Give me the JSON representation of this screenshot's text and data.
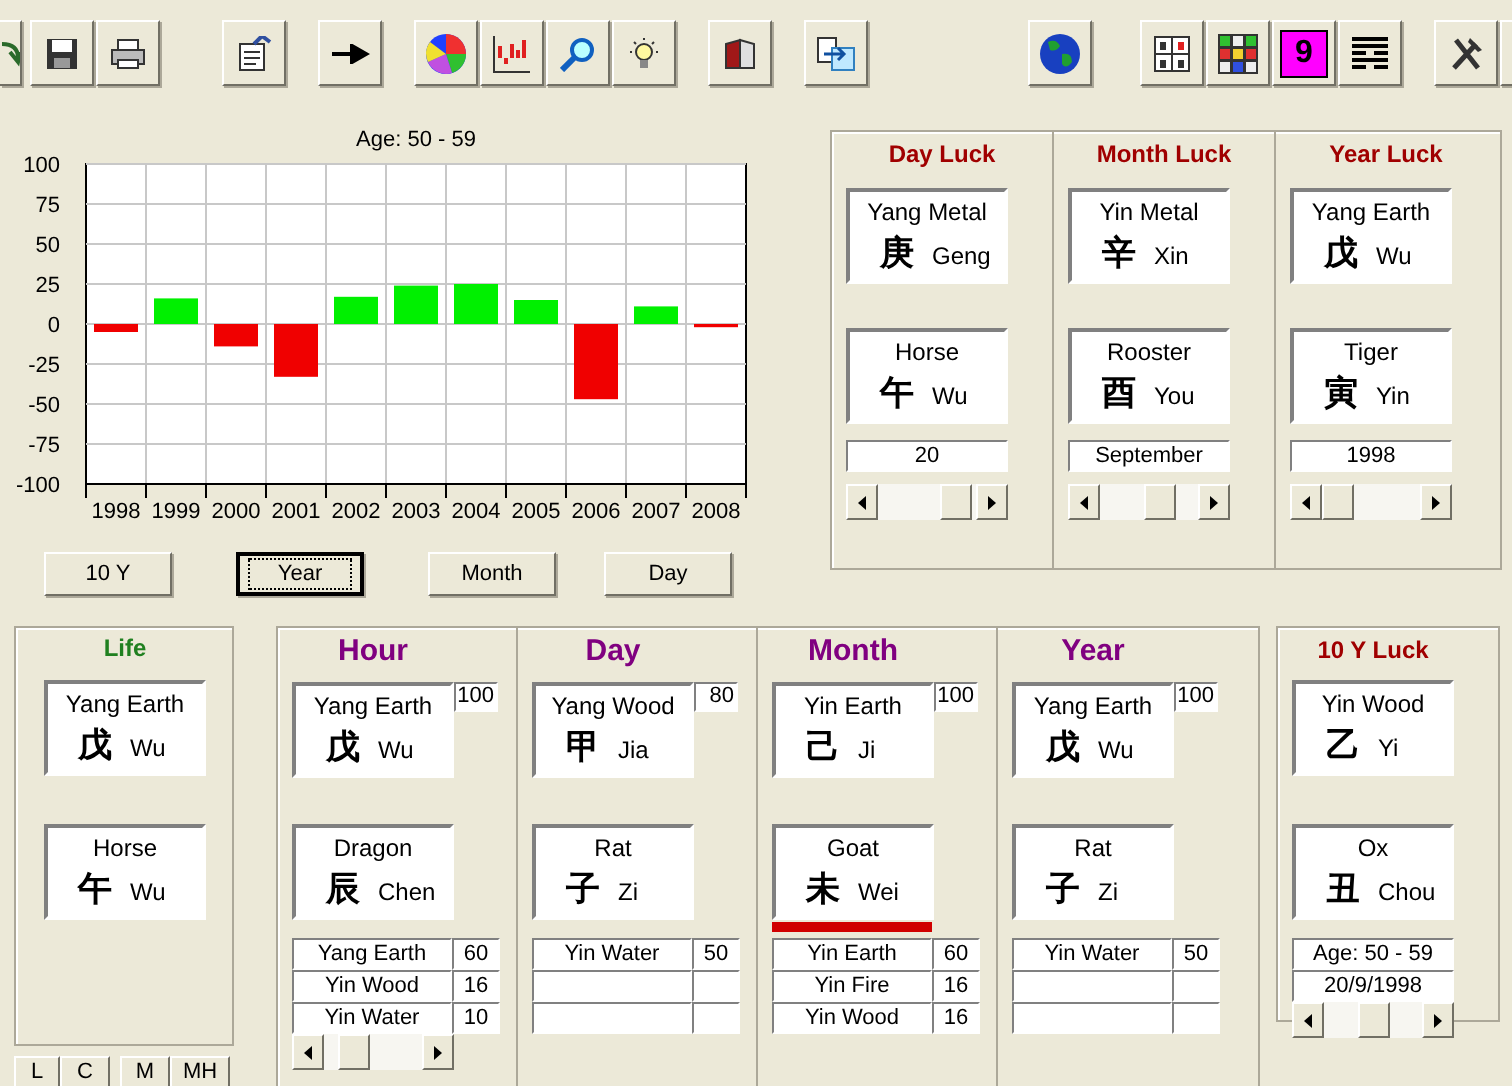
{
  "toolbar": {
    "number_button": "9"
  },
  "chart": {
    "title": "Age: 50 - 59",
    "chart_data": {
      "type": "bar",
      "categories": [
        "1998",
        "1999",
        "2000",
        "2001",
        "2002",
        "2003",
        "2004",
        "2005",
        "2006",
        "2007",
        "2008"
      ],
      "values": [
        -5,
        16,
        -14,
        -33,
        17,
        24,
        25,
        15,
        -47,
        11,
        -2
      ],
      "ylim": [
        -100,
        100
      ],
      "grid": true,
      "yticks": [
        100,
        75,
        50,
        25,
        0,
        -25,
        -50,
        -75,
        -100
      ]
    }
  },
  "period_buttons": [
    {
      "label": "10 Y",
      "selected": false
    },
    {
      "label": "Year",
      "selected": true
    },
    {
      "label": "Month",
      "selected": false
    },
    {
      "label": "Day",
      "selected": false
    }
  ],
  "luck_panels": [
    {
      "title": "Day Luck",
      "stem": {
        "element": "Yang Metal",
        "glyph": "庚",
        "pinyin": "Geng"
      },
      "branch": {
        "animal": "Horse",
        "glyph": "午",
        "pinyin": "Wu"
      },
      "value": "20",
      "level": 0.95
    },
    {
      "title": "Month Luck",
      "stem": {
        "element": "Yin Metal",
        "glyph": "辛",
        "pinyin": "Xin"
      },
      "branch": {
        "animal": "Rooster",
        "glyph": "酉",
        "pinyin": "You"
      },
      "value": "September",
      "level": 0.67
    },
    {
      "title": "Year Luck",
      "stem": {
        "element": "Yang Earth",
        "glyph": "戊",
        "pinyin": "Wu"
      },
      "branch": {
        "animal": "Tiger",
        "glyph": "寅",
        "pinyin": "Yin"
      },
      "value": "1998",
      "level": 0
    }
  ],
  "life": {
    "title": "Life",
    "stem": {
      "element": "Yang Earth",
      "glyph": "戊",
      "pinyin": "Wu"
    },
    "branch": {
      "animal": "Horse",
      "glyph": "午",
      "pinyin": "Wu"
    }
  },
  "mode_buttons": [
    "L",
    "C",
    "M",
    "MH"
  ],
  "pillars": [
    {
      "title": "Hour",
      "score": "100",
      "stem": {
        "element": "Yang Earth",
        "glyph": "戊",
        "pinyin": "Wu"
      },
      "branch": {
        "animal": "Dragon",
        "glyph": "辰",
        "pinyin": "Chen"
      },
      "marked": false,
      "hidden_stems": [
        {
          "name": "Yang Earth",
          "value": "60"
        },
        {
          "name": "Yin Wood",
          "value": "16"
        },
        {
          "name": "Yin Water",
          "value": "10"
        }
      ],
      "level": 0.2
    },
    {
      "title": "Day",
      "score": "80",
      "stem": {
        "element": "Yang Wood",
        "glyph": "甲",
        "pinyin": "Jia"
      },
      "branch": {
        "animal": "Rat",
        "glyph": "子",
        "pinyin": "Zi"
      },
      "marked": false,
      "hidden_stems": [
        {
          "name": "Yin Water",
          "value": "50"
        }
      ]
    },
    {
      "title": "Month",
      "score": "100",
      "stem": {
        "element": "Yin Earth",
        "glyph": "己",
        "pinyin": "Ji"
      },
      "branch": {
        "animal": "Goat",
        "glyph": "未",
        "pinyin": "Wei"
      },
      "marked": true,
      "hidden_stems": [
        {
          "name": "Yin Earth",
          "value": "60"
        },
        {
          "name": "Yin Fire",
          "value": "16"
        },
        {
          "name": "Yin Wood",
          "value": "16"
        }
      ]
    },
    {
      "title": "Year",
      "score": "100",
      "stem": {
        "element": "Yang Earth",
        "glyph": "戊",
        "pinyin": "Wu"
      },
      "branch": {
        "animal": "Rat",
        "glyph": "子",
        "pinyin": "Zi"
      },
      "marked": false,
      "hidden_stems": [
        {
          "name": "Yin Water",
          "value": "50"
        }
      ]
    }
  ],
  "ten_year_luck": {
    "title": "10 Y Luck",
    "stem": {
      "element": "Yin Wood",
      "glyph": "乙",
      "pinyin": "Yi"
    },
    "branch": {
      "animal": "Ox",
      "glyph": "丑",
      "pinyin": "Chou"
    },
    "age": "Age: 50 - 59",
    "date": "20/9/1998",
    "level": 0.5
  }
}
